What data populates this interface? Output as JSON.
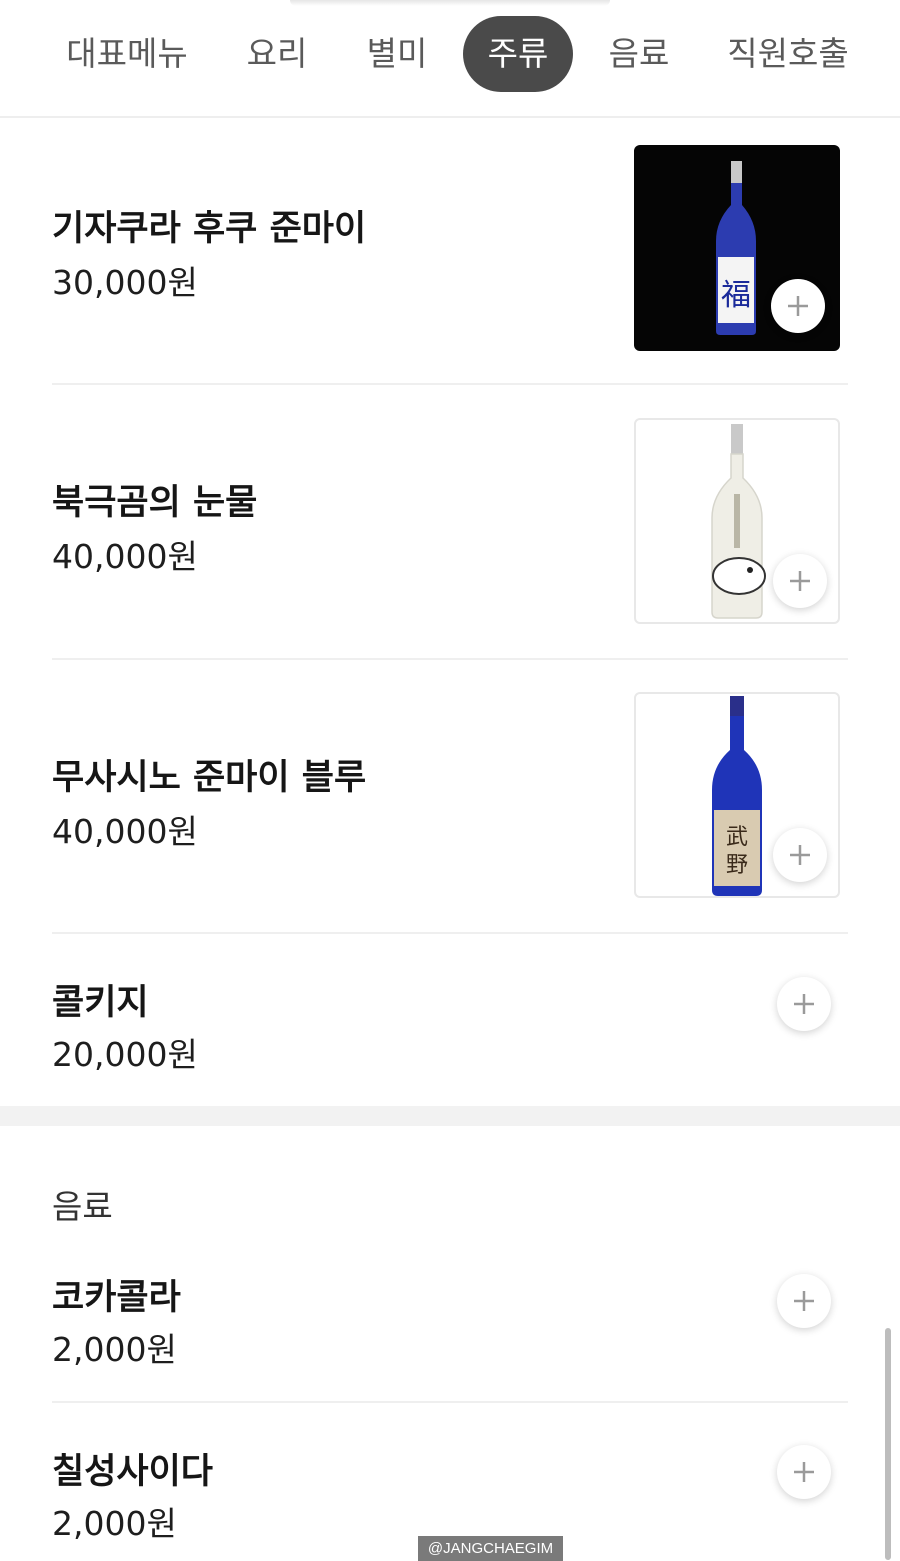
{
  "tabs": [
    {
      "label": "대표메뉴"
    },
    {
      "label": "요리"
    },
    {
      "label": "별미"
    },
    {
      "label": "주류",
      "active": true
    },
    {
      "label": "음료"
    },
    {
      "label": "직원호출"
    }
  ],
  "items": [
    {
      "name": "기자쿠라 후쿠 준마이",
      "price": "30,000원",
      "image": "blue-sake-bottle-dark"
    },
    {
      "name": "북극곰의 눈물",
      "price": "40,000원",
      "image": "white-sake-bottle-polar-bear"
    },
    {
      "name": "무사시노 준마이 블루",
      "price": "40,000원",
      "image": "blue-sake-bottle-gold-label"
    },
    {
      "name": "콜키지",
      "price": "20,000원"
    }
  ],
  "drinks_section": {
    "title": "음료",
    "items": [
      {
        "name": "코카콜라",
        "price": "2,000원"
      },
      {
        "name": "칠성사이다",
        "price": "2,000원"
      }
    ]
  },
  "watermark": "@JANGCHAEGIM",
  "colors": {
    "active_tab_bg": "#4a4a4a",
    "tab_text": "#5a5a5a",
    "divider": "#efefef",
    "plus_icon": "#9a9a9a"
  },
  "icons": [
    "plus-icon"
  ]
}
